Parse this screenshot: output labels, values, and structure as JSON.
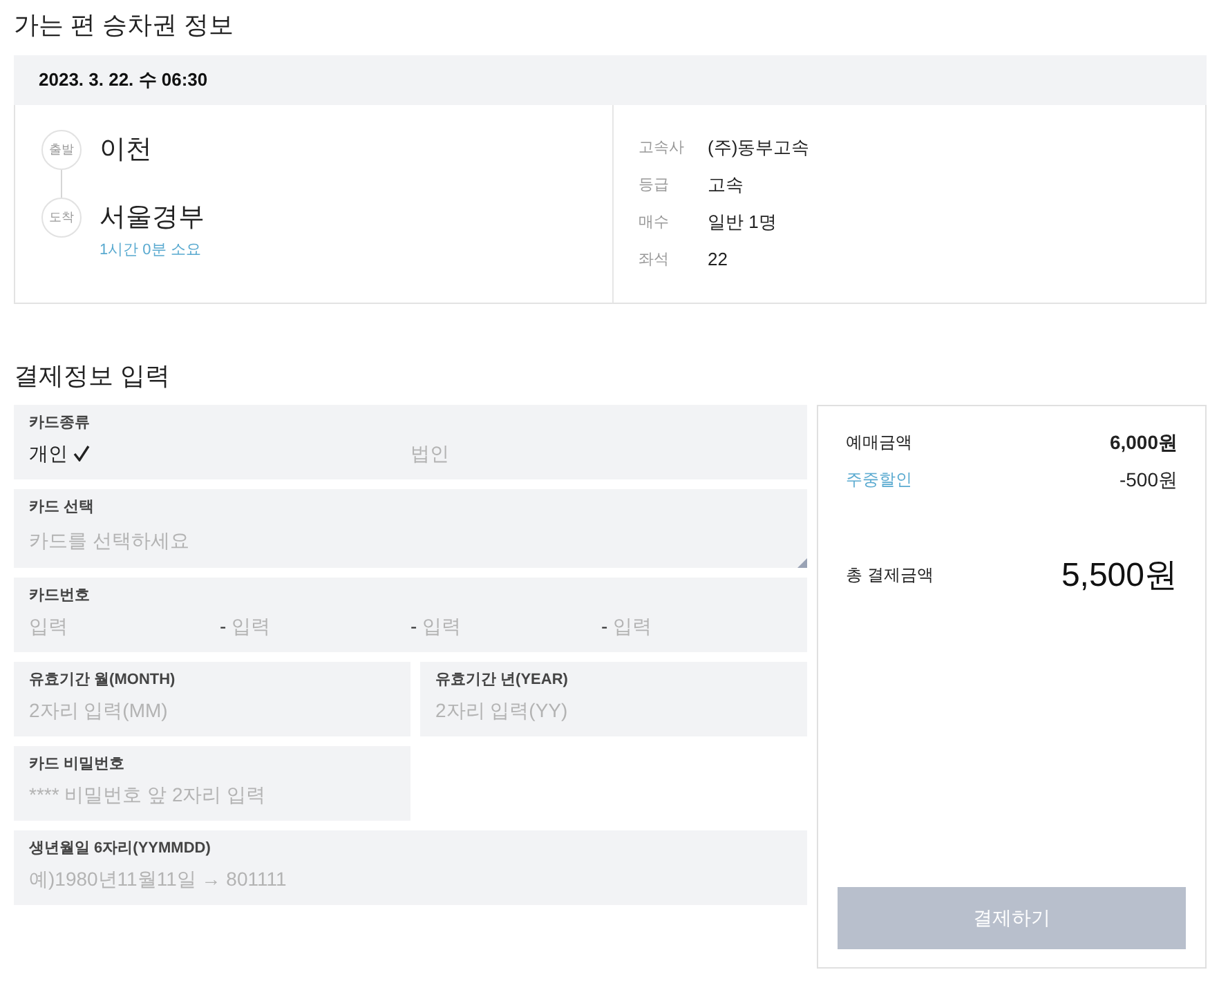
{
  "outbound_ticket": {
    "title": "가는 편 승차권 정보",
    "departure_datetime": "2023. 3. 22. 수 06:30",
    "route": {
      "stops": [
        {
          "badge": "출발",
          "station": "이천"
        },
        {
          "badge": "도착",
          "station": "서울경부"
        }
      ],
      "duration": "1시간 0분 소요"
    },
    "details": [
      {
        "label": "고속사",
        "value": "(주)동부고속"
      },
      {
        "label": "등급",
        "value": "고속"
      },
      {
        "label": "매수",
        "value": "일반 1명"
      },
      {
        "label": "좌석",
        "value": "22"
      }
    ]
  },
  "payment_form": {
    "title": "결제정보 입력",
    "fields": [
      {
        "kind": "choice",
        "label": "카드종류",
        "options": [
          {
            "label": "개인",
            "selected": true
          },
          {
            "label": "법인",
            "selected": false
          }
        ]
      },
      {
        "kind": "select",
        "label": "카드 선택",
        "placeholder": "카드를 선택하세요"
      },
      {
        "kind": "segmented",
        "label": "카드번호",
        "parts": [
          {
            "placeholder": "입력"
          },
          {
            "separator": "-",
            "placeholder": "입력"
          },
          {
            "separator": "-",
            "placeholder": "입력"
          },
          {
            "separator": "-",
            "placeholder": "입력"
          }
        ]
      },
      {
        "kind": "short",
        "label": "유효기간 월(MONTH)",
        "placeholder": "2자리 입력(MM)"
      },
      {
        "kind": "short",
        "label": "유효기간 년(YEAR)",
        "placeholder": "2자리 입력(YY)"
      },
      {
        "kind": "short",
        "label": "카드 비밀번호",
        "placeholder": "**** 비밀번호 앞 2자리 입력"
      },
      {
        "kind": "wide",
        "label": "생년월일 6자리(YYMMDD)",
        "placeholder": "예)1980년11월11일 → 801111"
      }
    ]
  },
  "payment_summary": {
    "lines": [
      {
        "kind": "fare",
        "label": "예매금액",
        "amount": "6,000원"
      },
      {
        "kind": "discount",
        "label": "주중할인",
        "amount": "-500원"
      }
    ],
    "total": {
      "label": "총 결제금액",
      "amount": "5,500원"
    },
    "pay_button": {
      "label": "결제하기",
      "disabled": true
    }
  }
}
